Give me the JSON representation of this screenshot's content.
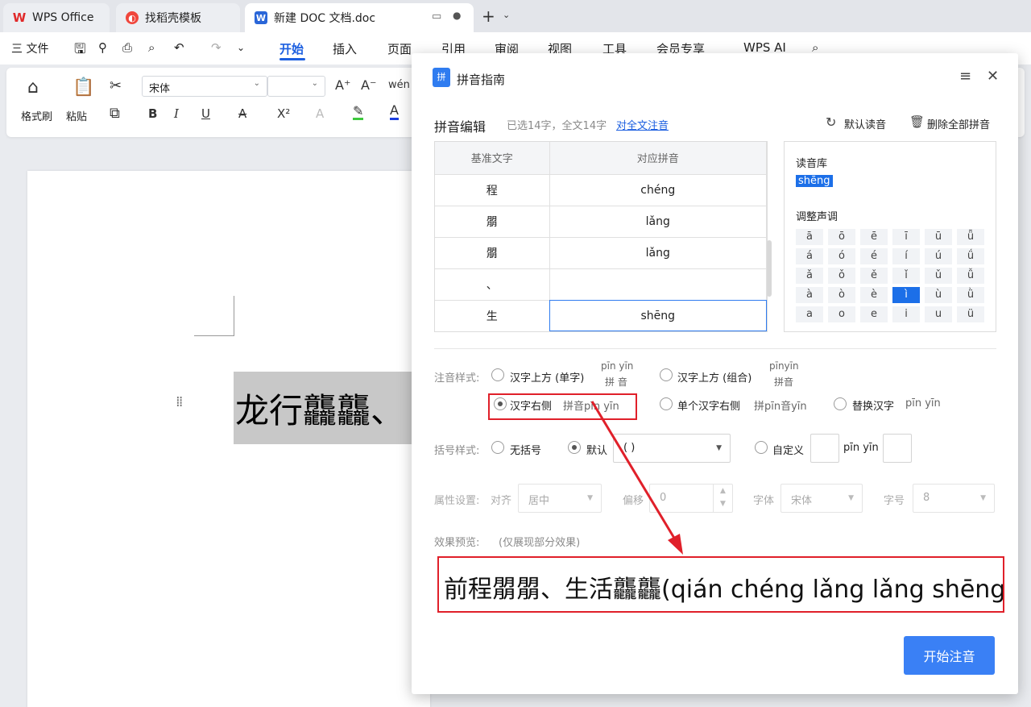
{
  "tabs": [
    {
      "label": "WPS Office"
    },
    {
      "label": "找稻壳模板"
    },
    {
      "label": "新建 DOC 文档.doc"
    }
  ],
  "menu": {
    "file": "三 文件",
    "items": [
      "开始",
      "插入",
      "页面",
      "引用",
      "审阅",
      "视图",
      "工具",
      "会员专享"
    ],
    "ai": "WPS AI"
  },
  "ribbon": {
    "format_painter": "格式刷",
    "paste": "粘贴",
    "font_name": "宋体",
    "font_size": "",
    "bold": "B",
    "italic": "I",
    "underline": "U",
    "strike": "A",
    "superscript": "X²",
    "grow": "A⁺",
    "shrink": "A⁻",
    "pinyin_btn": "wén"
  },
  "document": {
    "text": "龙行龘龘、"
  },
  "dialog": {
    "title": "拼音指南",
    "section_title": "拼音编辑",
    "selection_info": "已选14字，全文14字",
    "full_text_link": "对全文注音",
    "default_reading": "默认读音",
    "delete_all": "删除全部拼音",
    "table": {
      "headers": [
        "基准文字",
        "对应拼音"
      ],
      "rows": [
        {
          "char": "程",
          "pinyin": "chéng"
        },
        {
          "char": "朤",
          "pinyin": "lǎng"
        },
        {
          "char": "朤",
          "pinyin": "lǎng"
        },
        {
          "char": "、",
          "pinyin": ""
        },
        {
          "char": "生",
          "pinyin": "shēng"
        }
      ]
    },
    "library": {
      "label": "读音库",
      "current": "shēng",
      "tone_label": "调整声调",
      "tones": [
        [
          "ā",
          "ō",
          "ē",
          "ī",
          "ū",
          "ǖ"
        ],
        [
          "á",
          "ó",
          "é",
          "í",
          "ú",
          "ǘ"
        ],
        [
          "ǎ",
          "ǒ",
          "ě",
          "ǐ",
          "ǔ",
          "ǚ"
        ],
        [
          "à",
          "ò",
          "è",
          "ì",
          "ù",
          "ǜ"
        ],
        [
          "a",
          "o",
          "e",
          "i",
          "u",
          "ü"
        ]
      ]
    },
    "style": {
      "label": "注音样式:",
      "options": [
        {
          "label": "汉字上方 (单字)",
          "demo_top": "pīn yīn",
          "demo_bottom": "拼 音"
        },
        {
          "label": "汉字上方 (组合)",
          "demo_top": "pīnyīn",
          "demo_bottom": "拼音"
        },
        {
          "label": "汉字右侧",
          "demo": "拼音pīn yīn"
        },
        {
          "label": "单个汉字右侧",
          "demo": "拼pīn音yīn"
        },
        {
          "label": "替换汉字",
          "demo": "pīn yīn"
        }
      ]
    },
    "bracket": {
      "label": "括号样式:",
      "none": "无括号",
      "default": "默认",
      "default_value": "( )",
      "custom": "自定义",
      "custom_demo": "pīn yīn"
    },
    "attr": {
      "label": "属性设置:",
      "align_label": "对齐",
      "align_value": "居中",
      "offset_label": "偏移",
      "offset_value": "0",
      "font_label": "字体",
      "font_value": "宋体",
      "size_label": "字号",
      "size_value": "8"
    },
    "preview": {
      "label": "效果预览:",
      "note": "(仅展现部分效果)",
      "text": "前程朤朤、生活龘龘(qián chéng lǎng lǎng shēng"
    },
    "start_button": "开始注音"
  },
  "colors": {
    "accent": "#1c5fe0",
    "highlight": "#e0202a",
    "primary_button": "#3a80f5"
  }
}
